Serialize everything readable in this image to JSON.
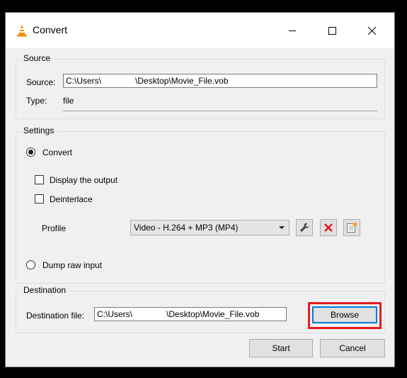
{
  "window": {
    "title": "Convert",
    "app_icon": "vlc-cone-icon",
    "controls": [
      "minimize-icon",
      "maximize-icon",
      "close-icon"
    ]
  },
  "source": {
    "group_title": "Source",
    "source_label": "Source:",
    "source_value_prefix": "C:\\Users\\",
    "source_value_suffix": "\\Desktop\\Movie_File.vob",
    "type_label": "Type:",
    "type_value": "file"
  },
  "settings": {
    "group_title": "Settings",
    "convert_label": "Convert",
    "convert_selected": true,
    "display_output_label": "Display the output",
    "display_output_checked": false,
    "deinterlace_label": "Deinterlace",
    "deinterlace_checked": false,
    "profile_label": "Profile",
    "profile_selected": "Video - H.264 + MP3 (MP4)",
    "profile_tool_icons": [
      "wrench-icon",
      "delete-x-icon",
      "new-profile-icon"
    ],
    "dump_raw_label": "Dump raw input",
    "dump_raw_selected": false
  },
  "destination": {
    "group_title": "Destination",
    "file_label": "Destination file:",
    "file_value_prefix": "C:\\Users\\",
    "file_value_suffix": "\\Desktop\\Movie_File.vob",
    "browse_label": "Browse"
  },
  "footer": {
    "start_label": "Start",
    "cancel_label": "Cancel"
  },
  "colors": {
    "highlight": "#e8191f",
    "focus": "#0078d7",
    "delete_icon": "#e81123",
    "vlc_orange": "#f28c00"
  }
}
